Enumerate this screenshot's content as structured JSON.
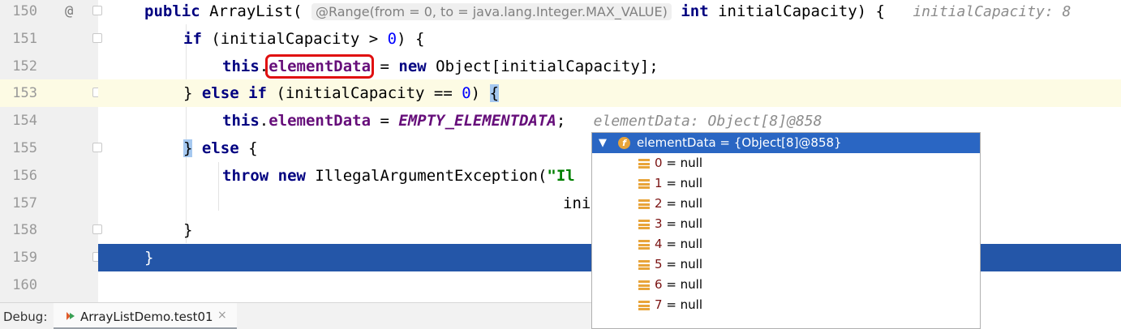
{
  "editor": {
    "line_numbers": [
      "150",
      "151",
      "152",
      "153",
      "154",
      "155",
      "156",
      "157",
      "158",
      "159",
      "160"
    ],
    "override_marker": "@",
    "lines": {
      "l150": {
        "kw_public": "public",
        "class_name": " ArrayList(",
        "annotation": "@Range(from = 0, to = java.lang.Integer.MAX_VALUE)",
        "kw_int": "int",
        "rest": " initialCapacity) {",
        "inlay": "initialCapacity: 8"
      },
      "l151": {
        "kw_if": "if",
        "cond": " (initialCapacity > ",
        "zero": "0",
        "close": ") {"
      },
      "l152": {
        "kw_this": "this",
        "dot": ".",
        "field": "elementData",
        "eq": " = ",
        "kw_new": "new",
        "rest": " Object[initialCapacity];"
      },
      "l153": {
        "close": "} ",
        "kw_else": "else",
        "sp": " ",
        "kw_if": "if",
        "cond": " (initialCapacity == ",
        "zero": "0",
        "paren": ") ",
        "brace": "{"
      },
      "l154": {
        "kw_this": "this",
        "dot": ".",
        "field": "elementData",
        "eq": " = ",
        "static_field": "EMPTY_ELEMENTDATA",
        "semi": ";",
        "inlay": "elementData: Object[8]@858"
      },
      "l155": {
        "brace": "}",
        "sp": " ",
        "kw_else": "else",
        "rest": " {"
      },
      "l156": {
        "kw_throw": "throw",
        "sp": " ",
        "kw_new": "new",
        "rest": " IllegalArgumentException(",
        "str": "\"Il"
      },
      "l157": {
        "text": "ini"
      },
      "l158": {
        "text": "}"
      },
      "l159": {
        "text": "}"
      }
    }
  },
  "popup": {
    "root_label": "elementData = {Object[8]@858}",
    "expand_icon": "chevron-down-icon",
    "field_icon_letter": "f",
    "items": [
      {
        "index": "0",
        "value": " = null"
      },
      {
        "index": "1",
        "value": " = null"
      },
      {
        "index": "2",
        "value": " = null"
      },
      {
        "index": "3",
        "value": " = null"
      },
      {
        "index": "4",
        "value": " = null"
      },
      {
        "index": "5",
        "value": " = null"
      },
      {
        "index": "6",
        "value": " = null"
      },
      {
        "index": "7",
        "value": " = null"
      }
    ]
  },
  "debug": {
    "label": "Debug:",
    "tab_label": "ArrayListDemo.test01",
    "close_glyph": "×"
  },
  "colors": {
    "keyword": "#000080",
    "field": "#660e7a",
    "number": "#0000ff",
    "string": "#008000",
    "execution_line": "#2456a8",
    "current_line": "#fdfbe4",
    "popup_selection": "#2a66c3",
    "highlight_box": "#e01010"
  }
}
